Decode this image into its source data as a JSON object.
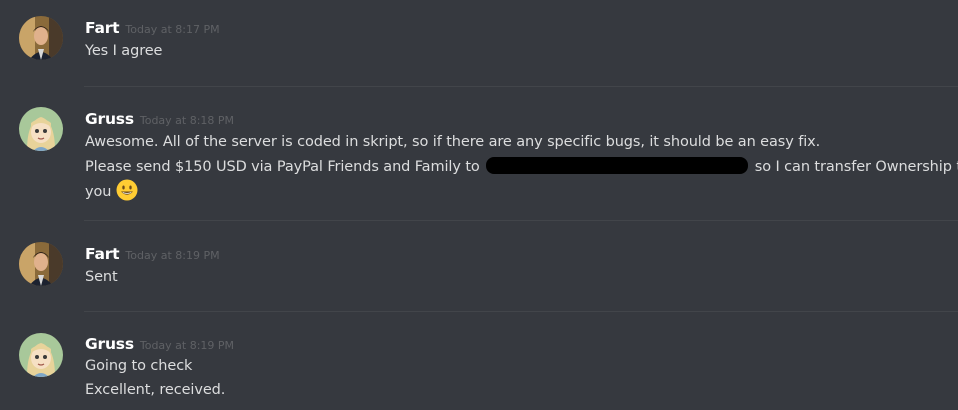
{
  "messages": [
    {
      "username": "Fart",
      "timestamp": "Today at 8:17 PM",
      "avatar_icon": "office-man-avatar",
      "lines": [
        "Yes I agree"
      ]
    },
    {
      "username": "Gruss",
      "timestamp": "Today at 8:18 PM",
      "avatar_icon": "cartoon-girl-avatar",
      "lines": [
        "Awesome. All of the server is coded in skript, so if there are any specific bugs, it should be an easy fix.",
        "Please send $150 USD via PayPal Friends and Family to",
        "so I can transfer Ownership to",
        "you"
      ],
      "emoji": "smiley-emoji"
    },
    {
      "username": "Fart",
      "timestamp": "Today at 8:19 PM",
      "avatar_icon": "office-man-avatar",
      "lines": [
        "Sent"
      ]
    },
    {
      "username": "Gruss",
      "timestamp": "Today at 8:19 PM",
      "avatar_icon": "cartoon-girl-avatar",
      "lines": [
        "Going to check",
        "Excellent, received."
      ]
    }
  ],
  "colors": {
    "background": "#36393f",
    "username": "#ffffff",
    "timestamp": "#5f6165",
    "text": "#dcddde",
    "divider": "#42454a"
  }
}
